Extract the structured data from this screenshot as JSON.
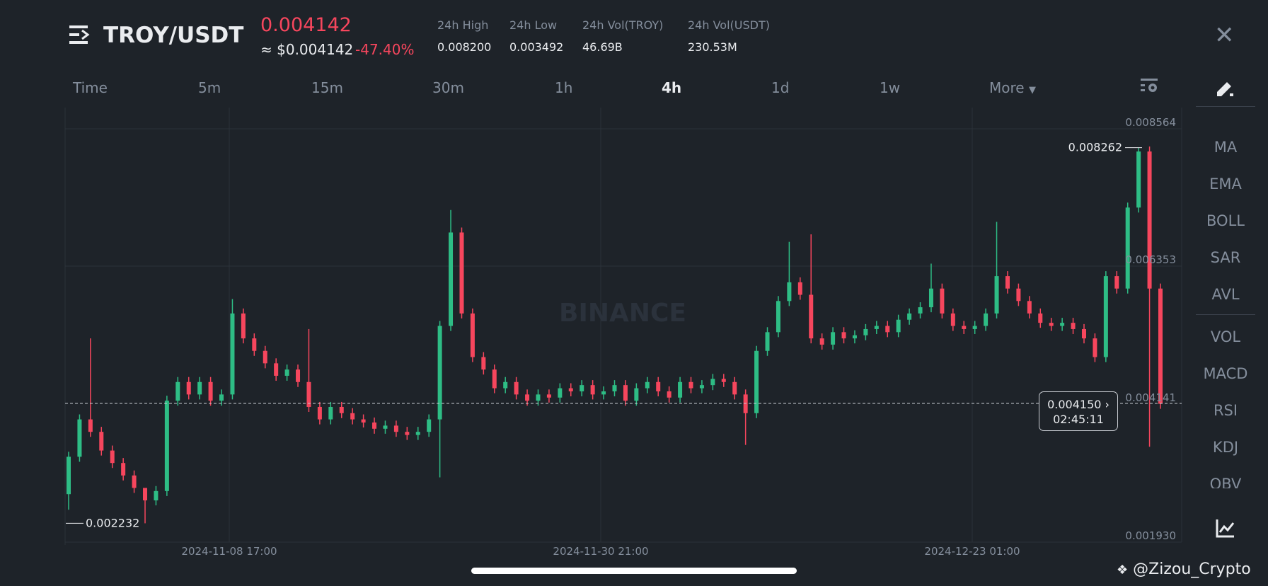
{
  "header": {
    "pair": "TROY/USDT",
    "last_price": "0.004142",
    "usd_price": "≈ $0.004142",
    "change": "-47.40%",
    "stats": [
      {
        "label": "24h High",
        "value": "0.008200"
      },
      {
        "label": "24h Low",
        "value": "0.003492"
      },
      {
        "label": "24h Vol(TROY)",
        "value": "46.69B"
      },
      {
        "label": "24h Vol(USDT)",
        "value": "230.53M"
      }
    ]
  },
  "timeframes": [
    "Time",
    "5m",
    "15m",
    "30m",
    "1h",
    "4h",
    "1d",
    "1w",
    "More"
  ],
  "active_timeframe": "4h",
  "indicators": [
    "MA",
    "EMA",
    "BOLL",
    "SAR",
    "AVL",
    "VOL",
    "MACD",
    "RSI",
    "KDJ",
    "OBV"
  ],
  "watermark": "BINANCE",
  "credit": "@Zizou_Crypto",
  "colors": {
    "up": "#2ebd85",
    "down": "#f6465d",
    "bg": "#1e2329"
  },
  "chart_data": {
    "type": "candlestick",
    "interval": "4h",
    "price_axis": {
      "ticks": [
        "0.008564",
        "0.006353",
        "0.004141",
        "0.001930"
      ],
      "range": [
        0.00193,
        0.008564
      ]
    },
    "time_axis": {
      "ticks": [
        "2024-11-08 17:00",
        "2024-11-30 21:00",
        "2024-12-23 01:00"
      ]
    },
    "max_label": "0.008262",
    "min_label": "0.002232",
    "current_price": {
      "value": "0.004150",
      "countdown": "02:45:11",
      "line_price": 0.004141
    },
    "first_open": 0.0027,
    "closes": [
      0.0033,
      0.0039,
      0.0037,
      0.0034,
      0.0032,
      0.003,
      0.0028,
      0.0026,
      0.00275,
      0.0042,
      0.0045,
      0.0043,
      0.0045,
      0.0042,
      0.0043,
      0.0056,
      0.0052,
      0.005,
      0.0048,
      0.0046,
      0.0047,
      0.0045,
      0.0041,
      0.0039,
      0.0041,
      0.004,
      0.0039,
      0.00385,
      0.00375,
      0.0038,
      0.0037,
      0.00365,
      0.0037,
      0.0039,
      0.0054,
      0.0069,
      0.0056,
      0.0049,
      0.0047,
      0.0044,
      0.0045,
      0.0043,
      0.0042,
      0.0043,
      0.00425,
      0.0044,
      0.00435,
      0.00445,
      0.0043,
      0.00435,
      0.00445,
      0.0042,
      0.0044,
      0.0045,
      0.00435,
      0.00425,
      0.0045,
      0.0044,
      0.00445,
      0.00455,
      0.0045,
      0.0043,
      0.004,
      0.005,
      0.0053,
      0.0058,
      0.0061,
      0.0059,
      0.0052,
      0.0051,
      0.0053,
      0.0052,
      0.00525,
      0.00535,
      0.0054,
      0.0053,
      0.0055,
      0.0056,
      0.0057,
      0.006,
      0.0056,
      0.0054,
      0.00535,
      0.0054,
      0.0056,
      0.0062,
      0.006,
      0.0058,
      0.0056,
      0.00545,
      0.0054,
      0.00545,
      0.00535,
      0.0052,
      0.0049,
      0.0062,
      0.006,
      0.0073,
      0.0082,
      0.006,
      0.00415
    ],
    "high_overrides": {
      "2": 0.0052,
      "7": 0.00275,
      "15": 0.00583,
      "22": 0.00535,
      "35": 0.00726,
      "66": 0.00675,
      "68": 0.00687,
      "79": 0.0064,
      "85": 0.00707,
      "98": 0.008262
    },
    "low_overrides": {
      "0": 0.00245,
      "7": 0.002232,
      "34": 0.00297,
      "62": 0.00349,
      "99": 0.00346
    }
  }
}
